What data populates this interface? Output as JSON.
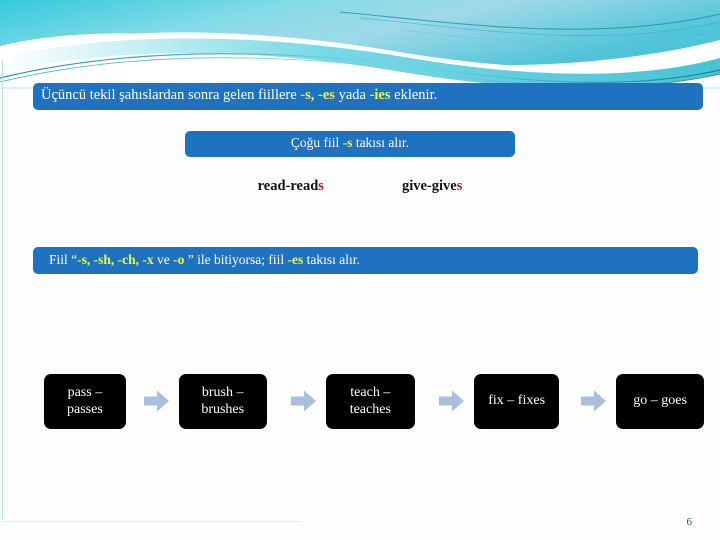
{
  "slide": {
    "page_number": "6",
    "accent_blue": "#1f72c0",
    "highlight_yellow": "#eaf53c",
    "suffix_red": "#a02020",
    "arrow_color": "#aabedd",
    "chip_bg": "#000000",
    "theme_teal": "#2fc4d6"
  },
  "title_banner": {
    "name": "title-banner",
    "part1": "Üçüncü tekil şahıslardan sonra gelen  fiillere ",
    "suffix1": "-s,",
    "part2": " ",
    "suffix2": "-es",
    "part3": " yada ",
    "suffix3": "-ies",
    "part4": " eklenir."
  },
  "sub_banner": {
    "name": "most-verbs-banner",
    "part1": "Çoğu fiil ",
    "suffix": "-s",
    "part2": " takısı alır."
  },
  "examples": [
    {
      "stem": "read-read",
      "suffix": "s"
    },
    {
      "stem": "give-give",
      "suffix": "s"
    }
  ],
  "rule_banner": {
    "name": "es-rule-banner",
    "part1": "Fiil “",
    "suffix1": "-s,",
    "sep1": " ",
    "suffix2": "-sh,",
    "sep2": " ",
    "suffix3": "-ch,",
    "sep3": " ",
    "suffix4": "-x",
    "sep4": "  ve ",
    "suffix5": "-o",
    "part2": " ” ile bitiyorsa; fiil ",
    "suffix6": "-es",
    "part3": " takısı alır."
  },
  "chips": [
    {
      "line1": "pass –",
      "line2": "passes"
    },
    {
      "line1": "brush –",
      "line2": "brushes"
    },
    {
      "line1": "teach –",
      "line2": "teaches"
    },
    {
      "line1": "fix – fixes",
      "line2": ""
    },
    {
      "line1": "go – goes",
      "line2": ""
    }
  ]
}
